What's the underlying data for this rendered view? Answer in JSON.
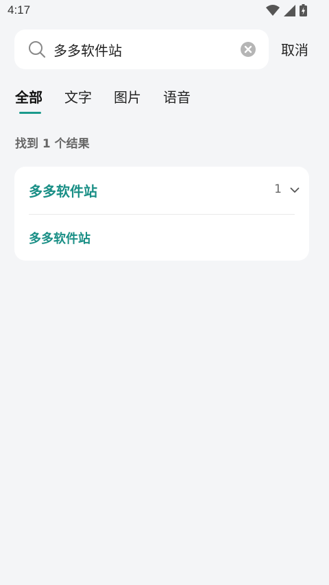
{
  "status_bar": {
    "time": "4:17",
    "icons": [
      "wifi-icon",
      "signal-icon",
      "battery-icon"
    ]
  },
  "search": {
    "value": "多多软件站",
    "cancel_label": "取消"
  },
  "tabs": [
    {
      "label": "全部",
      "active": true
    },
    {
      "label": "文字",
      "active": false
    },
    {
      "label": "图片",
      "active": false
    },
    {
      "label": "语音",
      "active": false
    }
  ],
  "results": {
    "summary": "找到 1 个结果",
    "groups": [
      {
        "title": "多多软件站",
        "count": "1",
        "items": [
          "多多软件站"
        ]
      }
    ]
  },
  "colors": {
    "accent": "#1a8f86",
    "background": "#f4f5f7",
    "card": "#ffffff"
  }
}
